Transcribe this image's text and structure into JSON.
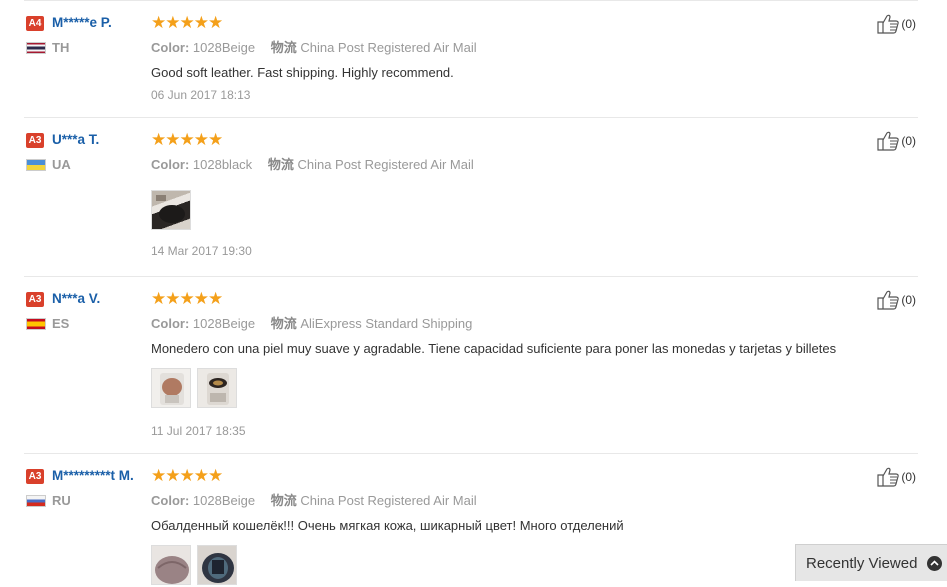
{
  "reviews": [
    {
      "level": "A4",
      "user": "M*****e P.",
      "country": "TH",
      "stars": "★★★★★",
      "color_label": "Color:",
      "color": "1028Beige",
      "ship_label": "物流",
      "shipping": "China Post Registered Air Mail",
      "text": "Good soft leather. Fast shipping. Highly recommend.",
      "date": "06 Jun 2017 18:13",
      "likes": "(0)"
    },
    {
      "level": "A3",
      "user": "U***a T.",
      "country": "UA",
      "stars": "★★★★★",
      "color_label": "Color:",
      "color": "1028black",
      "ship_label": "物流",
      "shipping": "China Post Registered Air Mail",
      "text": "",
      "date": "14 Mar 2017 19:30",
      "likes": "(0)"
    },
    {
      "level": "A3",
      "user": "N***a V.",
      "country": "ES",
      "stars": "★★★★★",
      "color_label": "Color:",
      "color": "1028Beige",
      "ship_label": "物流",
      "shipping": "AliExpress Standard Shipping",
      "text": "Monedero con una piel muy suave y agradable. Tiene capacidad suficiente para poner las monedas y tarjetas y billetes",
      "date": "11 Jul 2017 18:35",
      "likes": "(0)"
    },
    {
      "level": "A3",
      "user": "M*********t M.",
      "country": "RU",
      "stars": "★★★★★",
      "color_label": "Color:",
      "color": "1028Beige",
      "ship_label": "物流",
      "shipping": "China Post Registered Air Mail",
      "text": "Обалденный кошелёк!!! Очень мягкая кожа, шикарный цвет! Много отделений",
      "date": "",
      "likes": "(0)"
    }
  ],
  "recently_viewed": {
    "label": "Recently Viewed"
  },
  "icons": {
    "like": "thumbs-up-icon",
    "chevron": "chevron-up-icon"
  },
  "colors": {
    "level_badge": "#d9402b",
    "username": "#1a5fa8",
    "stars": "#f4a01a"
  }
}
